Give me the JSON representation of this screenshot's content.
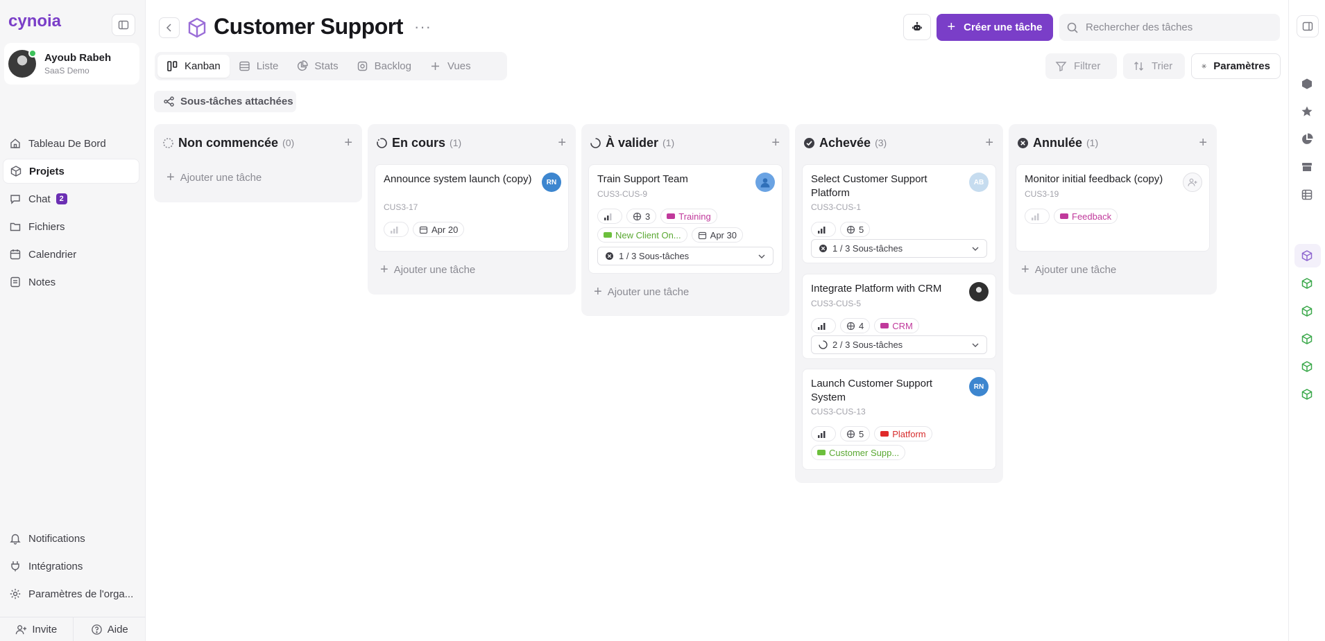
{
  "app": {
    "logo_text": "cynoia"
  },
  "user": {
    "name": "Ayoub Rabeh",
    "org": "SaaS Demo"
  },
  "nav": [
    {
      "label": "Tableau De Bord",
      "icon": "home-icon"
    },
    {
      "label": "Projets",
      "icon": "cube-icon",
      "active": true
    },
    {
      "label": "Chat",
      "icon": "chat-icon",
      "badge": "2"
    },
    {
      "label": "Fichiers",
      "icon": "folder-icon"
    },
    {
      "label": "Calendrier",
      "icon": "calendar-icon"
    },
    {
      "label": "Notes",
      "icon": "note-icon"
    }
  ],
  "nav_bottom": [
    {
      "label": "Notifications",
      "icon": "bell-icon"
    },
    {
      "label": "Intégrations",
      "icon": "plug-icon"
    },
    {
      "label": "Paramètres de l'orga...",
      "icon": "gear-icon"
    }
  ],
  "footer": {
    "invite": "Invite",
    "help": "Aide"
  },
  "header": {
    "title": "Customer Support",
    "create_label": "Créer une tâche",
    "search_placeholder": "Rechercher des tâches"
  },
  "tabs": [
    {
      "label": "Kanban",
      "icon": "kanban-icon",
      "active": true
    },
    {
      "label": "Liste",
      "icon": "list-icon"
    },
    {
      "label": "Stats",
      "icon": "pie-chart-icon"
    },
    {
      "label": "Backlog",
      "icon": "backlog-icon"
    },
    {
      "label": "Vues",
      "icon": "plus-icon"
    }
  ],
  "toolbar": {
    "filter": "Filtrer",
    "sort": "Trier",
    "settings": "Paramètres"
  },
  "subtasks_toggle": "Sous-tâches attachées",
  "add_task_label": "Ajouter une tâche",
  "colors": {
    "accent": "#7a3ec8",
    "done_green": "#3aa84a"
  },
  "columns": [
    {
      "title": "Non commencée",
      "count": "(0)",
      "status": "not-started"
    },
    {
      "title": "En cours",
      "count": "(1)",
      "status": "in-progress"
    },
    {
      "title": "À valider",
      "count": "(1)",
      "status": "to-validate"
    },
    {
      "title": "Achevée",
      "count": "(3)",
      "status": "done"
    },
    {
      "title": "Annulée",
      "count": "(1)",
      "status": "cancelled"
    }
  ],
  "cards": {
    "c1": {
      "title": "Announce system launch (copy)",
      "id": "CUS3-17",
      "avatar": "RN",
      "date": "Apr 20"
    },
    "c2": {
      "title": "Train Support Team",
      "id": "CUS3-CUS-9",
      "points": "3",
      "tag1": "Training",
      "tag2": "New Client On...",
      "date": "Apr 30",
      "subtasks": "1 / 3 Sous-tâches"
    },
    "c3": {
      "title": "Select Customer Support Platform",
      "id": "CUS3-CUS-1",
      "avatar": "AB",
      "points": "5",
      "subtasks": "1 / 3 Sous-tâches"
    },
    "c4": {
      "title": "Integrate Platform with CRM",
      "id": "CUS3-CUS-5",
      "points": "4",
      "tag1": "CRM",
      "subtasks": "2 / 3 Sous-tâches"
    },
    "c5": {
      "title": "Launch Customer Support System",
      "id": "CUS3-CUS-13",
      "avatar": "RN",
      "points": "5",
      "tag1": "Platform",
      "tag2": "Customer Supp..."
    },
    "c6": {
      "title": "Monitor initial feedback (copy)",
      "id": "CUS3-19",
      "tag1": "Feedback"
    }
  }
}
